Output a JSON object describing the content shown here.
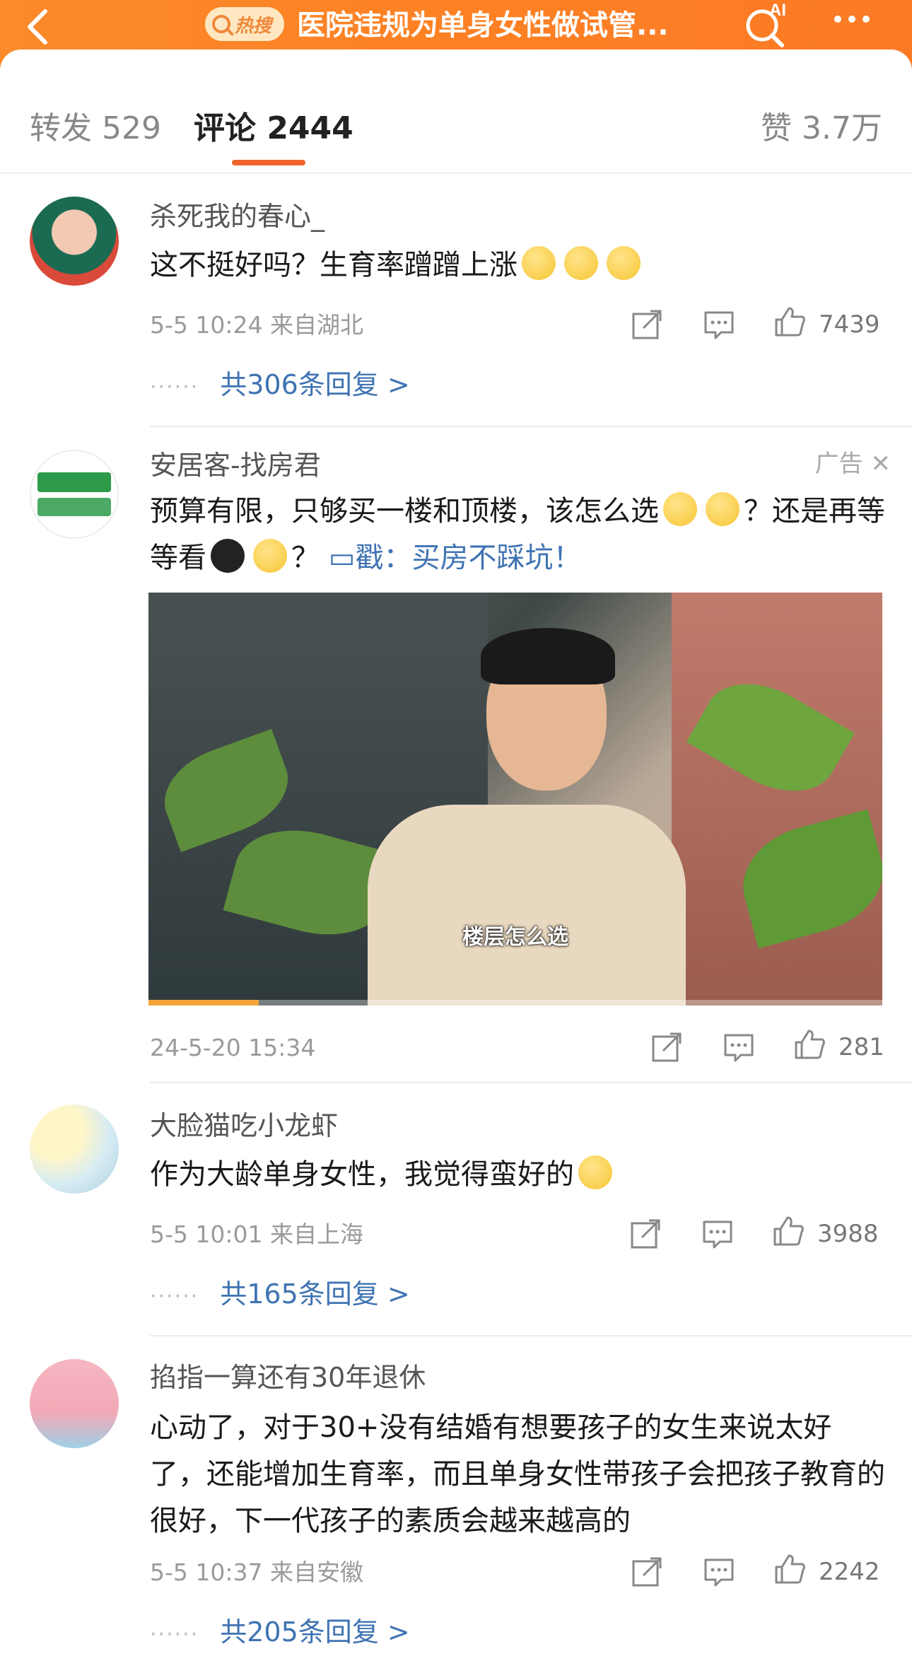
{
  "header": {
    "hot_label": "热搜",
    "title": "医院违规为单身女性做试管...",
    "ai_label": "AI"
  },
  "tabs": {
    "repost": "转发 529",
    "comments": "评论 2444",
    "likes": "赞 3.7万"
  },
  "comments": [
    {
      "username": "杀死我的春心_",
      "text": "这不挺好吗？生育率蹭蹭上涨",
      "time_location": "5-5 10:24  来自湖北",
      "likes": "7439",
      "replies": "共306条回复 >"
    },
    {
      "username": "安居客-找房君",
      "ad_label": "广告",
      "text_a": "预算有限，只够买一楼和顶楼，该怎么选",
      "text_b": "？还是再等等看",
      "text_c": "？",
      "link_text": "戳：买房不踩坑！",
      "video_caption": "楼层怎么选",
      "video_progress": 0.15,
      "time_location": "24-5-20 15:34",
      "likes": "281"
    },
    {
      "username": "大脸猫吃小龙虾",
      "text": "作为大龄单身女性，我觉得蛮好的",
      "time_location": "5-5 10:01  来自上海",
      "likes": "3988",
      "replies": "共165条回复 >"
    },
    {
      "username": "掐指一算还有30年退休",
      "text": "心动了，对于30+没有结婚有想要孩子的女生来说太好了，还能增加生育率，而且单身女性带孩子会把孩子教育的很好，下一代孩子的素质会越来越高的",
      "time_location": "5-5 10:37  来自安徽",
      "likes": "2242",
      "replies": "共205条回复 >"
    }
  ],
  "colors": {
    "header_orange": "#fd8124",
    "accent_underline": "#f0652b",
    "link_blue": "#3f73b3"
  }
}
